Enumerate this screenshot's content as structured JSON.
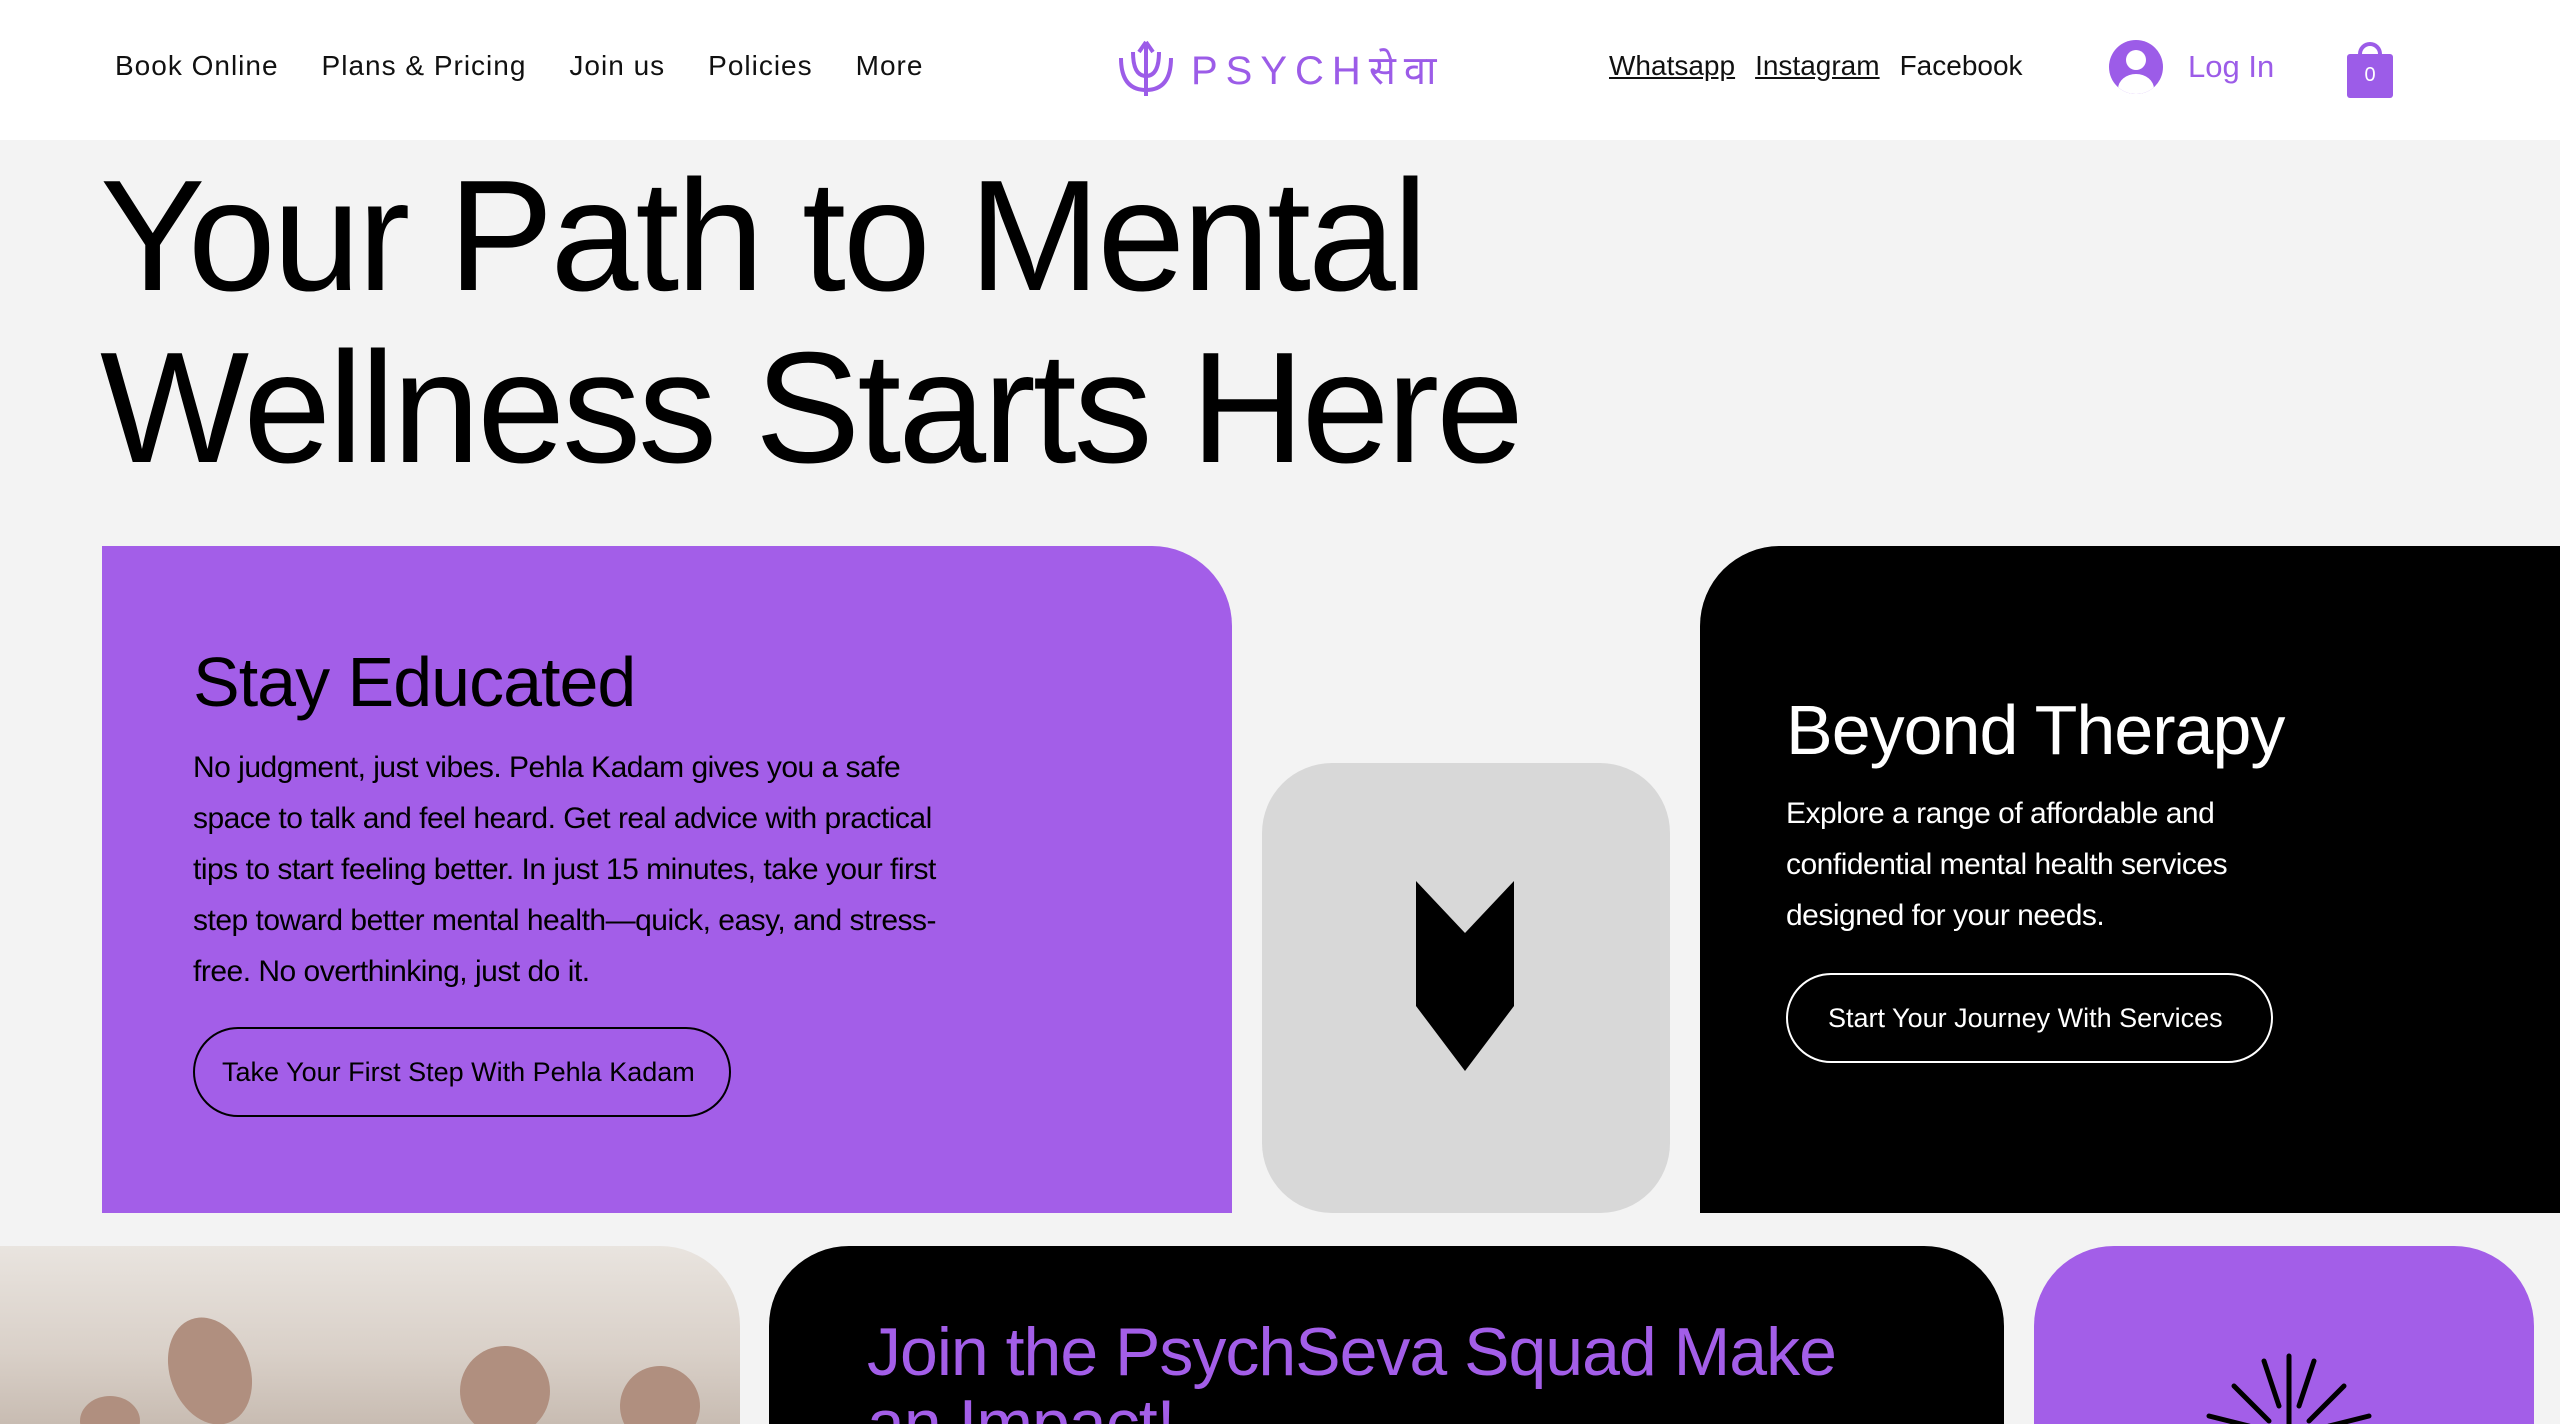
{
  "header": {
    "nav": [
      "Book Online",
      "Plans & Pricing",
      "Join us",
      "Policies",
      "More"
    ],
    "logo_text": "PSYCHसेवा",
    "social": [
      "Whatsapp",
      "Instagram",
      "Facebook"
    ],
    "login_label": "Log In",
    "cart_count": "0"
  },
  "hero": {
    "title_line1": "Your Path to Mental",
    "title_line2": "Wellness Starts Here"
  },
  "card_educated": {
    "title": "Stay Educated",
    "body": "No judgment, just vibes. Pehla Kadam gives you a safe space to talk and feel heard. Get real advice with practical tips to start feeling better. In just 15 minutes, take your first step toward better mental health—quick, easy, and stress-free. No overthinking, just do it.",
    "button": "Take Your First Step With Pehla Kadam"
  },
  "card_beyond": {
    "title": "Beyond Therapy",
    "body": "Explore a range of affordable and confidential mental health services designed for your needs.",
    "button": "Start Your Journey With Services"
  },
  "card_squad": {
    "title": "Join the PsychSeva Squad Make an Impact!"
  },
  "colors": {
    "accent": "#a35ee8",
    "logo_purple": "#9c5ce8",
    "dark": "#000000",
    "background": "#f3f3f3"
  }
}
